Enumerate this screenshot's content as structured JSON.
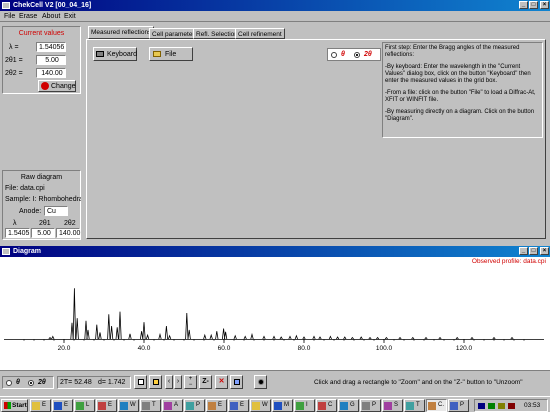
{
  "app": {
    "title": "ChekCell V2 [00_04_16]"
  },
  "menu": [
    "File",
    "Erase",
    "About",
    "Exit"
  ],
  "current_values": {
    "heading": "Current values",
    "lambda_label": "λ =",
    "lambda_value": "1.54056",
    "theta1_label": "2θ1 =",
    "theta1_value": "5.00",
    "theta2_label": "2θ2 =",
    "theta2_value": "140.00",
    "change_label": "Change"
  },
  "raw_diagram": {
    "heading": "Raw diagram",
    "file_text": "File: data.cpi",
    "sample_text": "Sample: I: Rhombohedral cell c",
    "anode_label": "Anode:",
    "anode_value": "Cu",
    "table_headers": [
      "λ",
      "2θ1",
      "2θ2"
    ],
    "table_values": [
      "1.5405",
      "5.00",
      "140.00"
    ]
  },
  "tabs": [
    "Measured reflections",
    "Cell parameters",
    "Refl. Selection",
    "Cell refinement"
  ],
  "toolbar": {
    "keyboard_label": "Keyboard",
    "file_label": "File"
  },
  "mode_radio": {
    "theta_label": "θ",
    "two_theta_label": "2θ",
    "selected": "2θ"
  },
  "help_text": [
    "First step: Enter the Bragg angles of the measured reflections:",
    "-By keyboard: Enter the wavelength in the \"Current Values\" dialog box, click on the button \"Keyboard\" then enter the measured values in the grid box.",
    "-From a file: click on the button \"File\" to load a Diffrac-At, XFIT or WINFIT file.",
    "-By measuring directly on a diagram. Click on the button \"Diagram\"."
  ],
  "diagram": {
    "title": "Diagram",
    "observed_label": "Observed profile: data.cpi",
    "x_ticks": [
      "20.0",
      "40.0",
      "60.0",
      "80.0",
      "100.0",
      "120.0"
    ],
    "x_range": [
      5,
      140
    ],
    "peaks": [
      [
        16.5,
        0.02
      ],
      [
        17.2,
        0.04
      ],
      [
        22.0,
        0.25
      ],
      [
        22.6,
        0.78
      ],
      [
        23.3,
        0.32
      ],
      [
        25.5,
        0.28
      ],
      [
        26.0,
        0.14
      ],
      [
        28.2,
        0.22
      ],
      [
        29.0,
        0.1
      ],
      [
        31.2,
        0.38
      ],
      [
        31.9,
        0.2
      ],
      [
        33.3,
        0.18
      ],
      [
        34.0,
        0.42
      ],
      [
        36.5,
        0.08
      ],
      [
        39.4,
        0.12
      ],
      [
        40.0,
        0.26
      ],
      [
        40.9,
        0.06
      ],
      [
        44.0,
        0.07
      ],
      [
        45.6,
        0.2
      ],
      [
        46.4,
        0.05
      ],
      [
        50.7,
        0.4
      ],
      [
        51.3,
        0.14
      ],
      [
        55.2,
        0.06
      ],
      [
        56.8,
        0.06
      ],
      [
        58.2,
        0.12
      ],
      [
        59.9,
        0.16
      ],
      [
        60.4,
        0.11
      ],
      [
        62.8,
        0.05
      ],
      [
        65.3,
        0.04
      ],
      [
        67.0,
        0.07
      ],
      [
        70.0,
        0.04
      ],
      [
        72.5,
        0.04
      ],
      [
        74.3,
        0.03
      ],
      [
        76.5,
        0.04
      ],
      [
        78.1,
        0.05
      ],
      [
        80.0,
        0.03
      ],
      [
        82.5,
        0.04
      ],
      [
        84.0,
        0.03
      ],
      [
        86.6,
        0.04
      ],
      [
        88.4,
        0.03
      ],
      [
        90.2,
        0.03
      ],
      [
        92.1,
        0.02
      ],
      [
        94.3,
        0.03
      ],
      [
        96.5,
        0.02
      ],
      [
        98.4,
        0.02
      ],
      [
        100.6,
        0.02
      ],
      [
        104.0,
        0.02
      ],
      [
        107.2,
        0.02
      ],
      [
        110.5,
        0.02
      ],
      [
        114.0,
        0.015
      ],
      [
        118.3,
        0.015
      ],
      [
        122.0,
        0.012
      ],
      [
        127.5,
        0.012
      ],
      [
        132.0,
        0.01
      ]
    ]
  },
  "diagram_toolbar": {
    "theta_label": "θ",
    "two_theta_label": "2θ",
    "readout_2t": "2T= 52.48",
    "readout_d": "d= 1.742",
    "z_minus_label": "Z-",
    "hint": "Click and drag a rectangle to \"Zoom\" and on the \"Z-\" button to \"Unzoom\""
  },
  "taskbar": {
    "start_label": "Start",
    "tasks": [
      "E",
      "E",
      "L",
      "E",
      "W",
      "T",
      "A",
      "P",
      "E",
      "E",
      "W",
      "M",
      "I",
      "C",
      "G",
      "P",
      "S",
      "T",
      "C.",
      "P"
    ],
    "active_task_index": 18,
    "clock": "03:53"
  }
}
